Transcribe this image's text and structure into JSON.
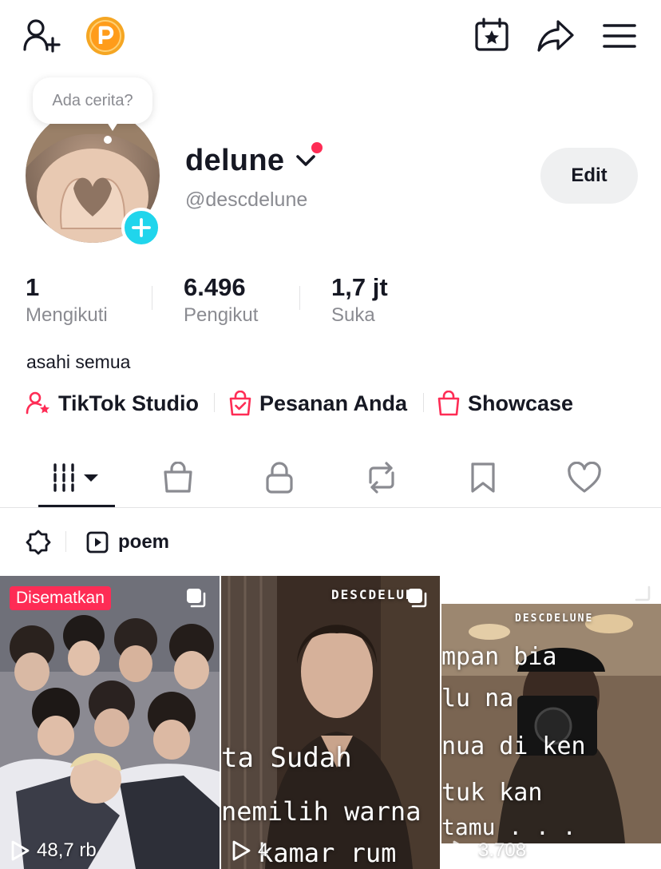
{
  "profile": {
    "story_prompt": "Ada cerita?",
    "display_name": "delune",
    "username": "@descdelune",
    "edit_label": "Edit",
    "bio": "asahi semua"
  },
  "stats": [
    {
      "value": "1",
      "label": "Mengikuti"
    },
    {
      "value": "6.496",
      "label": "Pengikut"
    },
    {
      "value": "1,7 jt",
      "label": "Suka"
    }
  ],
  "shortcuts": [
    {
      "label": "TikTok Studio",
      "icon": "person-star-icon"
    },
    {
      "label": "Pesanan Anda",
      "icon": "order-bag-icon"
    },
    {
      "label": "Showcase",
      "icon": "shopping-bag-icon"
    }
  ],
  "tabs": [
    "videos-grid-icon",
    "shop-bag-icon",
    "lock-icon",
    "repost-icon",
    "bookmark-icon",
    "heart-icon"
  ],
  "filter": {
    "playlist_label": "poem"
  },
  "videos": [
    {
      "pinned_label": "Disematkan",
      "views": "48,7 rb"
    },
    {
      "overlay_watermark": "DESCDELUNE",
      "overlay_line1": "ta  Sudah",
      "overlay_line2": "nemilih  warna",
      "overlay_line3": "kamar  rum",
      "views": "4"
    },
    {
      "overlay_watermark": "DESCDELUNE",
      "overlay_line1": "mpan     bia",
      "overlay_line2": "lu       na",
      "overlay_line3": "nua   di ken",
      "overlay_line4": "tuk      kan",
      "overlay_line5": "tamu . . .",
      "views": "3.708"
    }
  ],
  "colors": {
    "accent_red": "#fe2c55",
    "add_blue": "#20d5ec",
    "text_primary": "#161823",
    "text_secondary": "#8a8b91",
    "coin_orange": "#f5a623"
  }
}
